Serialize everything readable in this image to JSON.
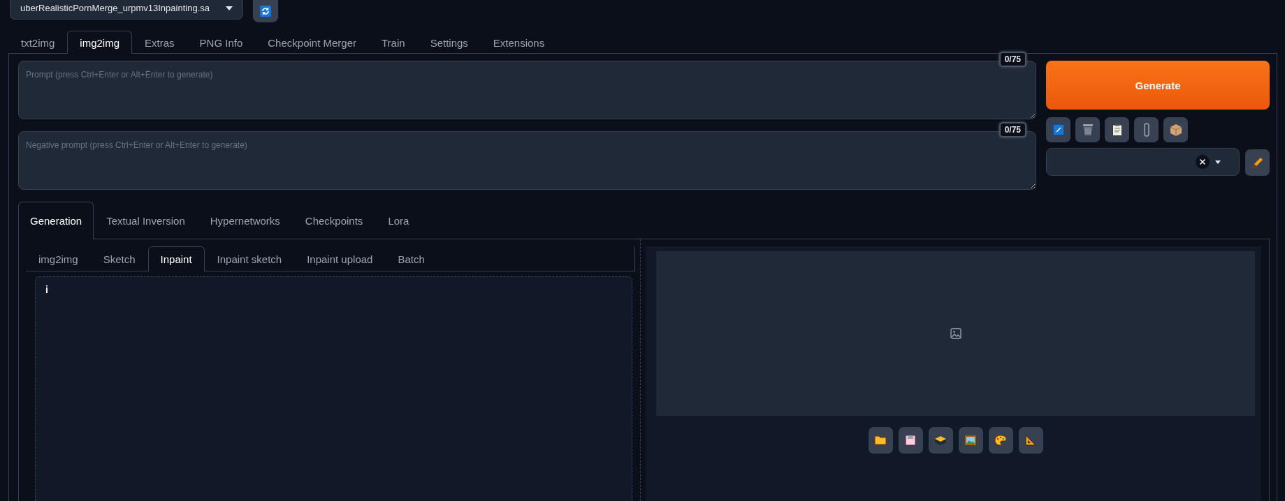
{
  "model_select": {
    "value": "uberRealisticPornMerge_urpmv13Inpainting.sa"
  },
  "main_tabs": [
    {
      "label": "txt2img",
      "selected": false
    },
    {
      "label": "img2img",
      "selected": true
    },
    {
      "label": "Extras",
      "selected": false
    },
    {
      "label": "PNG Info",
      "selected": false
    },
    {
      "label": "Checkpoint Merger",
      "selected": false
    },
    {
      "label": "Train",
      "selected": false
    },
    {
      "label": "Settings",
      "selected": false
    },
    {
      "label": "Extensions",
      "selected": false
    }
  ],
  "prompt": {
    "placeholder": "Prompt (press Ctrl+Enter or Alt+Enter to generate)",
    "token_count": "0/75"
  },
  "negative_prompt": {
    "placeholder": "Negative prompt (press Ctrl+Enter or Alt+Enter to generate)",
    "token_count": "0/75"
  },
  "generate_button": {
    "label": "Generate"
  },
  "extra_tabs": [
    {
      "label": "Generation",
      "selected": true
    },
    {
      "label": "Textual Inversion",
      "selected": false
    },
    {
      "label": "Hypernetworks",
      "selected": false
    },
    {
      "label": "Checkpoints",
      "selected": false
    },
    {
      "label": "Lora",
      "selected": false
    }
  ],
  "input_tabs": [
    {
      "label": "img2img",
      "selected": false
    },
    {
      "label": "Sketch",
      "selected": false
    },
    {
      "label": "Inpaint",
      "selected": true
    },
    {
      "label": "Inpaint sketch",
      "selected": false
    },
    {
      "label": "Inpaint upload",
      "selected": false
    },
    {
      "label": "Batch",
      "selected": false
    }
  ],
  "canvas": {
    "info_label": "i"
  }
}
